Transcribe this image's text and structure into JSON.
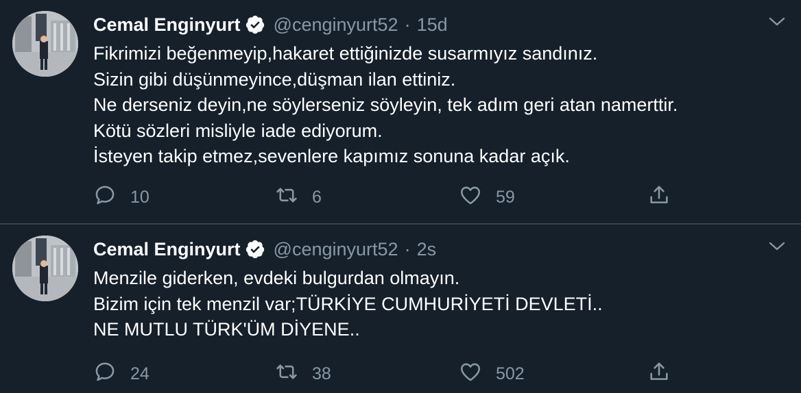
{
  "tweets": [
    {
      "author_name": "Cemal Enginyurt",
      "handle": "@cenginyurt52",
      "separator": "·",
      "time": "15d",
      "lines": [
        "Fikrimizi beğenmeyip,hakaret ettiğinizde susarmıyız sandınız.",
        "Sizin gibi düşünmeyince,düşman ilan ettiniz.",
        "Ne derseniz deyin,ne söylerseniz söyleyin, tek adım geri atan namerttir.",
        "Kötü sözleri misliyle iade ediyorum.",
        "İsteyen takip etmez,sevenlere kapımız sonuna kadar açık."
      ],
      "replies": "10",
      "retweets": "6",
      "likes": "59"
    },
    {
      "author_name": "Cemal Enginyurt",
      "handle": "@cenginyurt52",
      "separator": "·",
      "time": "2s",
      "lines": [
        "Menzile giderken, evdeki bulgurdan olmayın.",
        "Bizim için tek menzil var;TÜRKİYE CUMHURİYETİ DEVLETİ..",
        "NE MUTLU TÜRK'ÜM DİYENE.."
      ],
      "replies": "24",
      "retweets": "38",
      "likes": "502"
    }
  ],
  "icons": {
    "verified": "verified-badge-icon",
    "more": "chevron-down-icon",
    "reply": "reply-icon",
    "retweet": "retweet-icon",
    "like": "heart-icon",
    "share": "share-icon"
  },
  "colors": {
    "background": "#15202b",
    "text": "#ffffff",
    "secondary": "#8899a6",
    "divider": "#38444d"
  }
}
